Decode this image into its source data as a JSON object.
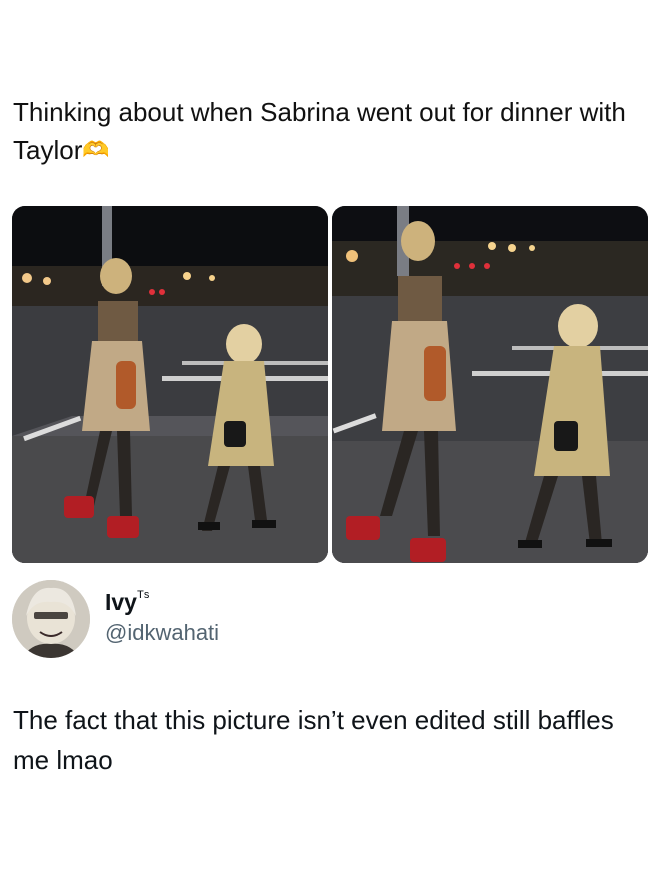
{
  "caption": {
    "text": "Thinking about when Sabrina went out for dinner with Taylor",
    "emoji": "🫶"
  },
  "photos": {
    "count": 2,
    "subject": "street-photo"
  },
  "tweet": {
    "display_name": "Ivy",
    "name_suffix": "ᵀˢ",
    "handle": "@idkwahati",
    "text": "The fact that this picture isn’t even edited still baffles me lmao"
  },
  "colors": {
    "text": "#0f1419",
    "secondary": "#536471",
    "background": "#ffffff"
  }
}
